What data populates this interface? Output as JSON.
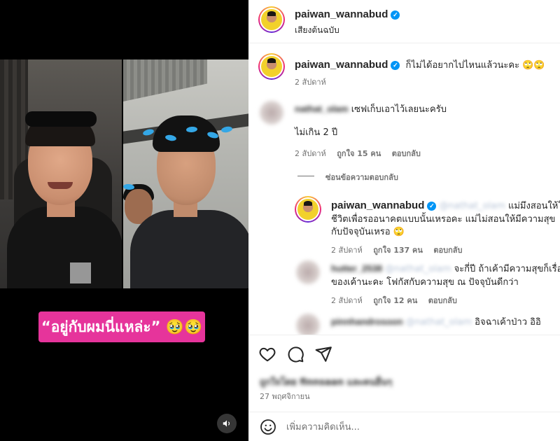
{
  "video": {
    "caption": "“อยู่กับผมนี่แหล่ะ” 🥹🥹",
    "mute_icon": "speaker-icon"
  },
  "header": {
    "username": "paiwan_wannabud",
    "subtitle": "เสียงต้นฉบับ",
    "verified_icon": "verified-badge-icon"
  },
  "caption_post": {
    "username": "paiwan_wannabud",
    "text": "ก็ไม่ได้อยากไปไหนแล้วนะคะ 🙄🙄",
    "time": "2 สัปดาห์"
  },
  "comments": [
    {
      "username": "nathat_olam",
      "line1": "เซฟเก็บเอาไว้เลยนะครับ",
      "line2": "ไม่เกิน 2 ปี",
      "time": "2 สัปดาห์",
      "likes": "ถูกใจ 15 คน",
      "reply": "ตอบกลับ"
    }
  ],
  "hide_replies": "ซ่อนข้อความตอบกลับ",
  "replies": [
    {
      "username": "paiwan_wannabud",
      "mention": "@nathat_olam",
      "line1": "แม่มึงสอนให้ใช้",
      "line2": "ชีวิตเพื่อรออนาคตแบบนั้นเหรอคะ แม่ไม่สอนให้มีความสุข",
      "line3": "กับปัจจุบันเหรอ 🙄",
      "time": "2 สัปดาห์",
      "likes": "ถูกใจ 137 คน",
      "reply": "ตอบกลับ"
    },
    {
      "username": "hutter_2538",
      "mention": "@nathat_olam",
      "line1": "จะกี่ปี ถ้าเค้ามีความสุขก็เรื่อง",
      "line2": "ของเค้านะคะ โฟกัสกับความสุข ณ ปัจจุบันดีกว่า",
      "time": "2 สัปดาห์",
      "likes": "ถูกใจ 12 คน",
      "reply": "ตอบกลับ"
    },
    {
      "username": "pinnhandrosoon",
      "mention": "@nathat_olam",
      "line1": "อิจฉาเค้าป่าว อิอิ"
    }
  ],
  "actions": {
    "like_icon": "heart-icon",
    "comment_icon": "comment-icon",
    "share_icon": "send-icon",
    "liked_by": "ถูกใจโดย finnsaan และคนอื่นๆ",
    "date": "27 พฤศจิกายน"
  },
  "add_comment": {
    "placeholder": "เพิ่มความคิดเห็น...",
    "emoji_icon": "emoji-smile-icon"
  },
  "colors": {
    "caption_bg": "#e6349b",
    "verified": "#0095f6",
    "meta_text": "#737373"
  }
}
